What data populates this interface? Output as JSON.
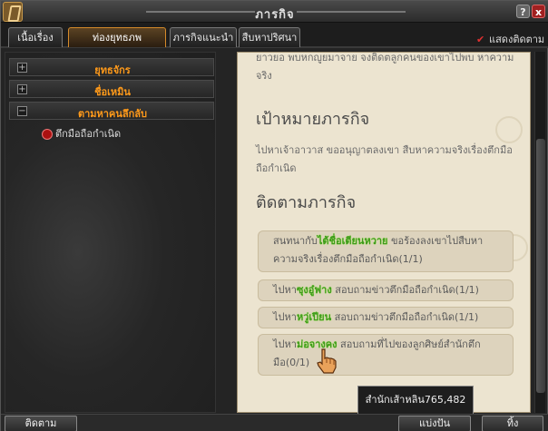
{
  "window": {
    "title": "ภารกิจ",
    "help_label": "?",
    "close_label": "x"
  },
  "tabs": [
    {
      "label": "เนื้อเรื่อง",
      "active": false
    },
    {
      "label": "ท่องยุทธภพ",
      "active": true
    },
    {
      "label": "ภารกิจแนะนำ",
      "active": false
    },
    {
      "label": "สืบหาปริศนา",
      "active": false
    }
  ],
  "show_tracking": {
    "label": "แสดงติดตาม",
    "checked": true
  },
  "categories": [
    {
      "label": "ยุทธจักร",
      "sign": "+"
    },
    {
      "label": "ชื่อเหมิน",
      "sign": "+"
    },
    {
      "label": "ตามหาคนลึกลับ",
      "sign": "−"
    }
  ],
  "quest_item": "ตึกมือถือกำเนิด",
  "detail": {
    "intro": "ยาวยอ พบหกญูยมาจาย จงติดตลูกคนของเขาไปพบ หาความจริง",
    "goal_title": "เป้าหมายภารกิจ",
    "goal_text": "ไปหาเจ้าอาวาส ขออนุญาตลงเขา สืบหาความจริงเรื่องตึกมือถือกำเนิด",
    "track_title": "ติดตามภารกิจ",
    "tasks": [
      {
        "pre": "สนทนากับ",
        "name": "ไต้ชื่อเตียนหวาย",
        "post": " ขอร้องลงเขาไปสืบหาความจริงเรื่องตึกมือถือกำเนิด(1/1)"
      },
      {
        "pre": "ไปหา",
        "name": "ซุงอู๋ฟาง",
        "post": " สอบถามข่าวตึกมือถือกำเนิด(1/1)"
      },
      {
        "pre": "ไปหา",
        "name": "หวู่เปียน",
        "post": " สอบถามข่าวตึกมือถือกำเนิด(1/1)"
      },
      {
        "pre": "ไปหา",
        "name": "ม่อจางคง",
        "post": " สอบถามที่ไปของลูกศิษย์สำนักตึกมือ(0/1)"
      }
    ]
  },
  "tooltip": "สำนักเส้าหลิน765,482",
  "buttons": {
    "track": "ติดตาม",
    "share": "แบ่งปัน",
    "drop": "ทิ้ง"
  },
  "colors": {
    "accent": "#ff9a1a",
    "highlight": "#3e9a1c",
    "active_tab": "#d58a2a"
  }
}
